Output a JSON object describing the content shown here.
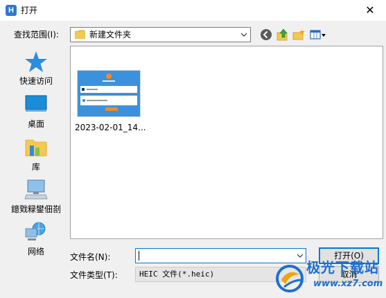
{
  "window": {
    "title": "打开",
    "app_icon_letter": "H"
  },
  "lookin": {
    "label": "查找范围(I):",
    "value": "新建文件夹"
  },
  "toolbar": {
    "icons": [
      "back-icon",
      "up-folder-icon",
      "new-folder-icon",
      "view-menu-icon"
    ]
  },
  "places": [
    {
      "label": "快速访问",
      "icon": "star-icon"
    },
    {
      "label": "桌面",
      "icon": "desktop-icon"
    },
    {
      "label": "库",
      "icon": "library-icon"
    },
    {
      "label": "鐿戣粶鐢佃剳",
      "icon": "computer-icon"
    },
    {
      "label": "网络",
      "icon": "network-icon"
    }
  ],
  "files": [
    {
      "name": "2023-02-01_14..."
    }
  ],
  "filename": {
    "label": "文件名(N):",
    "value": ""
  },
  "filetype": {
    "label": "文件类型(T):",
    "value": "HEIC 文件(*.heic)"
  },
  "buttons": {
    "open": "打开(O)",
    "cancel": "取消"
  },
  "watermark": {
    "name": "极光下载站",
    "url": "www.xz7.com"
  },
  "colors": {
    "accent": "#0078d7",
    "brand": "#1d6fd0"
  }
}
